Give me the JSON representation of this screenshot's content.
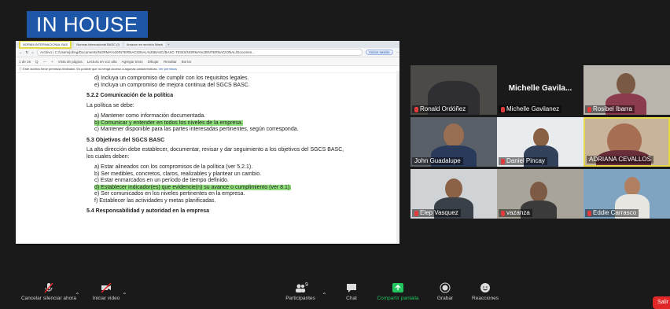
{
  "brand": "IN HOUSE",
  "browser": {
    "tabs": [
      "NORMA INTERNACIONAL BAS",
      "Normas internacional BASC (I)",
      "Amazon en servicio Wash",
      "+"
    ],
    "url": "Archivo | C:/Users/johng/Documents/NORMA%20INTERNACIONAL%20BASC/BASC-TESIS/NORMA%20INTERNACIONAL/Documen...",
    "sync_label": "Iniciar sesión",
    "pdf_toolbar": [
      "1 de 16",
      "Q",
      "—",
      "+",
      "Vista de página",
      "Lectura en voz alta",
      "Agregar texto",
      "Dibujar",
      "Resaltar",
      "Borrar"
    ],
    "notice": "Este archivo tiene permisos limitados. Es posible que no tenga acceso a algunas características.",
    "notice_link": "Ver permisos"
  },
  "document": {
    "line_d": "d)   Incluya un compromiso de cumplir con los requisitos legales.",
    "line_e": "e)   Incluya un compromiso de mejora continua del SGCS BASC.",
    "h1": "5.2.2   Comunicación de la política",
    "p1": "La política se debe:",
    "a1": "a)   Mantener como información documentada.",
    "b1": "b)   Comunicar y entender en todos los niveles de la empresa.",
    "c1": "c)   Mantener disponible para las partes interesadas pertinentes, según corresponda.",
    "h2": "5.3     Objetivos del SGCS BASC",
    "p2": "La alta dirección debe establecer, documentar, revisar y dar seguimiento a los objetivos del SGCS BASC, los cuales deben:",
    "a2": "a)   Estar alineados con los compromisos de la política (ver 5.2.1).",
    "b2": "b)   Ser medibles, concretos, claros, realizables y plantear un cambio.",
    "c2": "c)   Estar enmarcados en un período de tiempo definido.",
    "d2": "d)   Establecer indicador(es) que evidencie(n) su avance o cumplimiento (ver 8.1).",
    "e2": "e)   Ser comunicados en los niveles pertinentes en la empresa.",
    "f2": "f)    Establecer las actividades y metas planificadas.",
    "h3": "5.4     Responsabilidad y autoridad en la empresa"
  },
  "participants": {
    "ronald": "Ronald Ordóñez",
    "michelle_big": "Michelle Gavila...",
    "michelle": "Michelle Gavilanez",
    "rosibel": "Rosibel Ibarra",
    "john": "John Guadalupe",
    "daniel": "Daniel Pincay",
    "adriana": "ADRIANA CEVALLOS",
    "elep": "Elep Vasquez",
    "vazanza": "vazanza",
    "eddie": "Eddie Carrasco"
  },
  "toolbar": {
    "audio": "Cancelar silenciar ahora",
    "video": "Iniciar video",
    "participants": "Participantes",
    "participants_count": "9",
    "chat": "Chat",
    "share": "Compartir pantalla",
    "record": "Grabar",
    "reactions": "Reacciones",
    "leave": "Salir"
  },
  "colors": {
    "brand": "#1f57a8",
    "highlight": "#8fe07a",
    "active_border": "#e7d84a",
    "share_green": "#22c55e",
    "leave_red": "#e02828"
  }
}
